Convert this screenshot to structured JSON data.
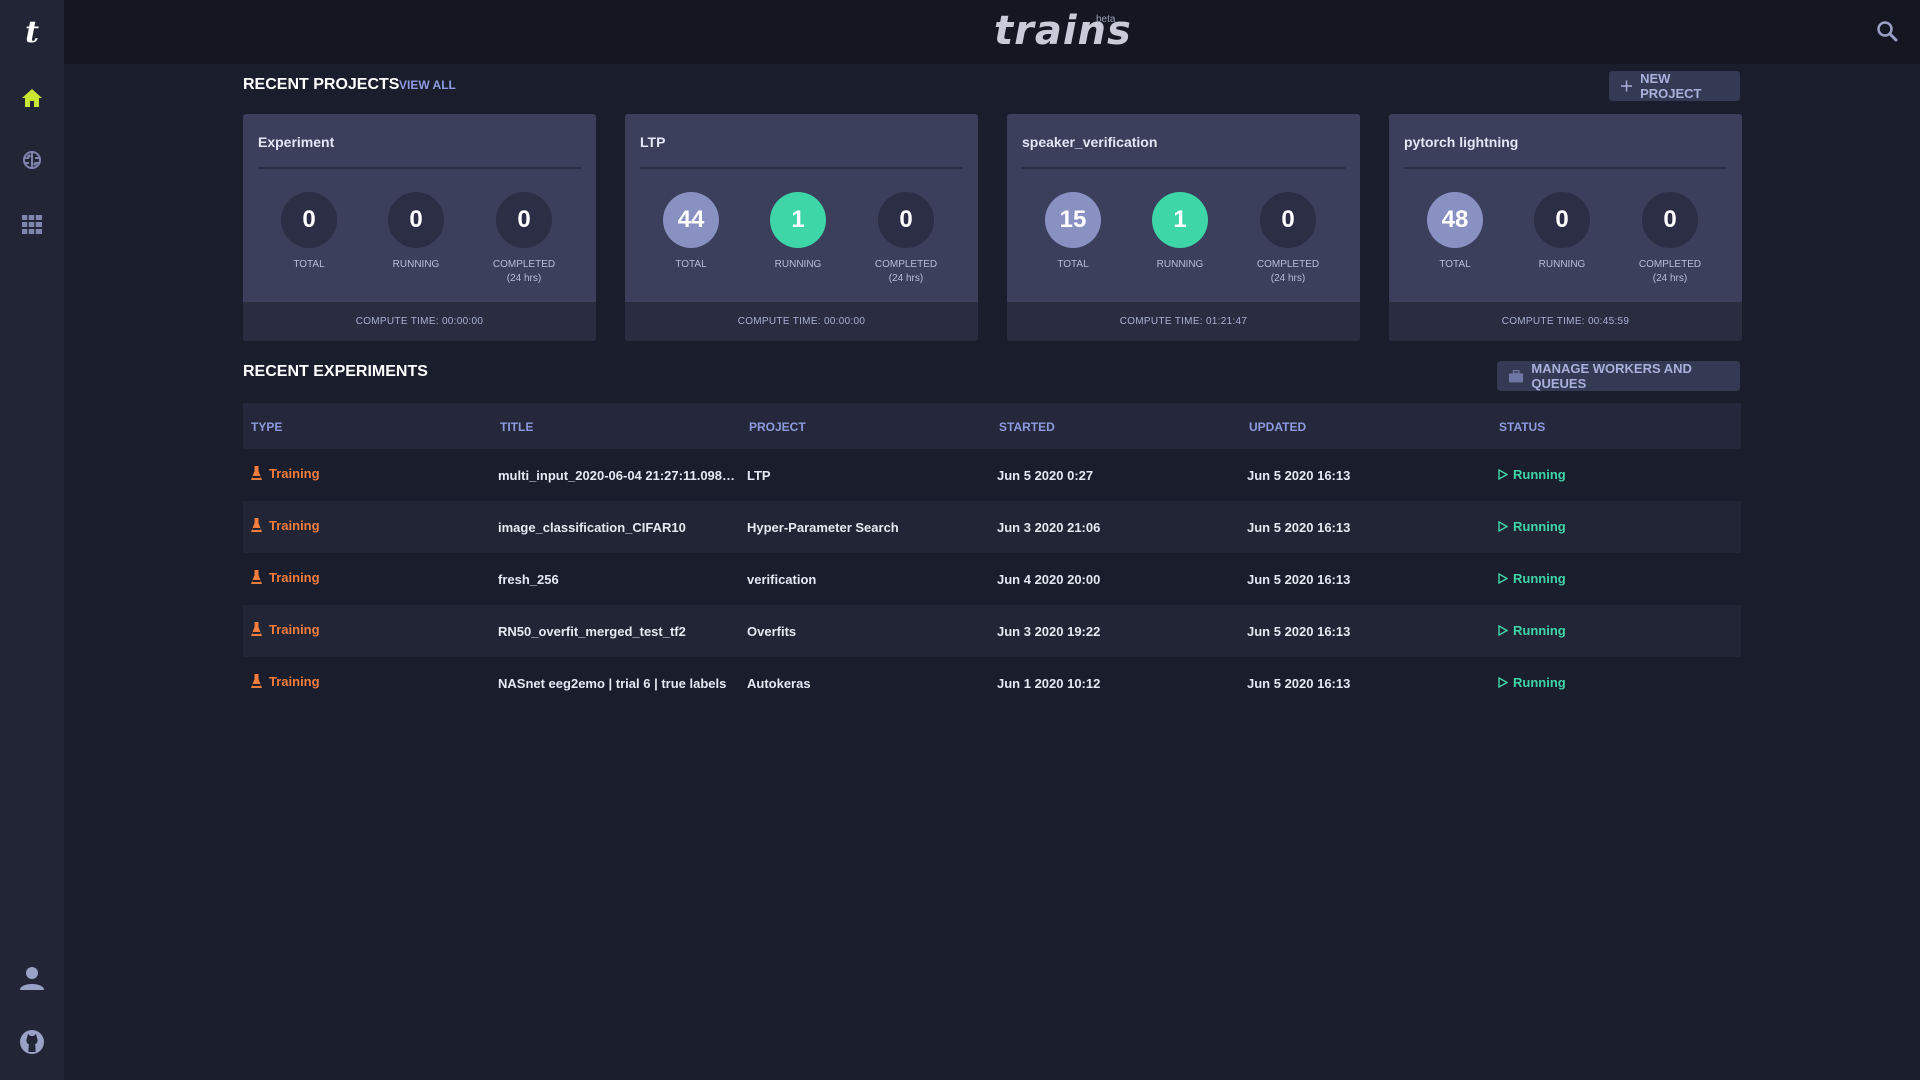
{
  "sidebar": {
    "logo_letter": "t",
    "items": [
      {
        "name": "home",
        "icon": "home-icon"
      },
      {
        "name": "projects",
        "icon": "brain-icon"
      },
      {
        "name": "workers",
        "icon": "server-grid-icon"
      }
    ],
    "bottom": [
      {
        "name": "profile",
        "icon": "user-icon"
      },
      {
        "name": "github",
        "icon": "github-icon"
      }
    ]
  },
  "header": {
    "brand": "trains",
    "beta": "beta",
    "search_icon": "search-icon"
  },
  "projects_section": {
    "title": "RECENT PROJECTS",
    "view_all": "VIEW ALL",
    "new_project": "NEW PROJECT"
  },
  "stat_labels": {
    "total": "TOTAL",
    "running": "RUNNING",
    "completed": "COMPLETED",
    "completed_sub": "(24 hrs)"
  },
  "projects": [
    {
      "name": "Experiment",
      "total": "0",
      "running": "0",
      "completed": "0",
      "compute_time": "COMPUTE TIME: 00:00:00"
    },
    {
      "name": "LTP",
      "total": "44",
      "running": "1",
      "completed": "0",
      "compute_time": "COMPUTE TIME: 00:00:00"
    },
    {
      "name": "speaker_verification",
      "total": "15",
      "running": "1",
      "completed": "0",
      "compute_time": "COMPUTE TIME: 01:21:47"
    },
    {
      "name": "pytorch lightning",
      "total": "48",
      "running": "0",
      "completed": "0",
      "compute_time": "COMPUTE TIME: 00:45:59"
    }
  ],
  "experiments_section": {
    "title": "RECENT EXPERIMENTS",
    "manage_button": "MANAGE WORKERS AND QUEUES",
    "columns": [
      "TYPE",
      "TITLE",
      "PROJECT",
      "STARTED",
      "UPDATED",
      "STATUS"
    ],
    "rows": [
      {
        "type": "Training",
        "title": "multi_input_2020-06-04 21:27:11.0989...",
        "project": "LTP",
        "started": "Jun 5 2020 0:27",
        "updated": "Jun 5 2020 16:13",
        "status": "Running"
      },
      {
        "type": "Training",
        "title": "image_classification_CIFAR10",
        "project": "Hyper-Parameter Search",
        "started": "Jun 3 2020 21:06",
        "updated": "Jun 5 2020 16:13",
        "status": "Running"
      },
      {
        "type": "Training",
        "title": "fresh_256",
        "project": "verification",
        "started": "Jun 4 2020 20:00",
        "updated": "Jun 5 2020 16:13",
        "status": "Running"
      },
      {
        "type": "Training",
        "title": "RN50_overfit_merged_test_tf2",
        "project": "Overfits",
        "started": "Jun 3 2020 19:22",
        "updated": "Jun 5 2020 16:13",
        "status": "Running"
      },
      {
        "type": "Training",
        "title": "NASnet eeg2emo | trial 6 | true labels",
        "project": "Autokeras",
        "started": "Jun 1 2020 10:12",
        "updated": "Jun 5 2020 16:13",
        "status": "Running"
      }
    ]
  },
  "colors": {
    "accent": "#8e9ae0",
    "running": "#3ed6a7",
    "training": "#f27d3c",
    "home_active": "#c8e632"
  }
}
